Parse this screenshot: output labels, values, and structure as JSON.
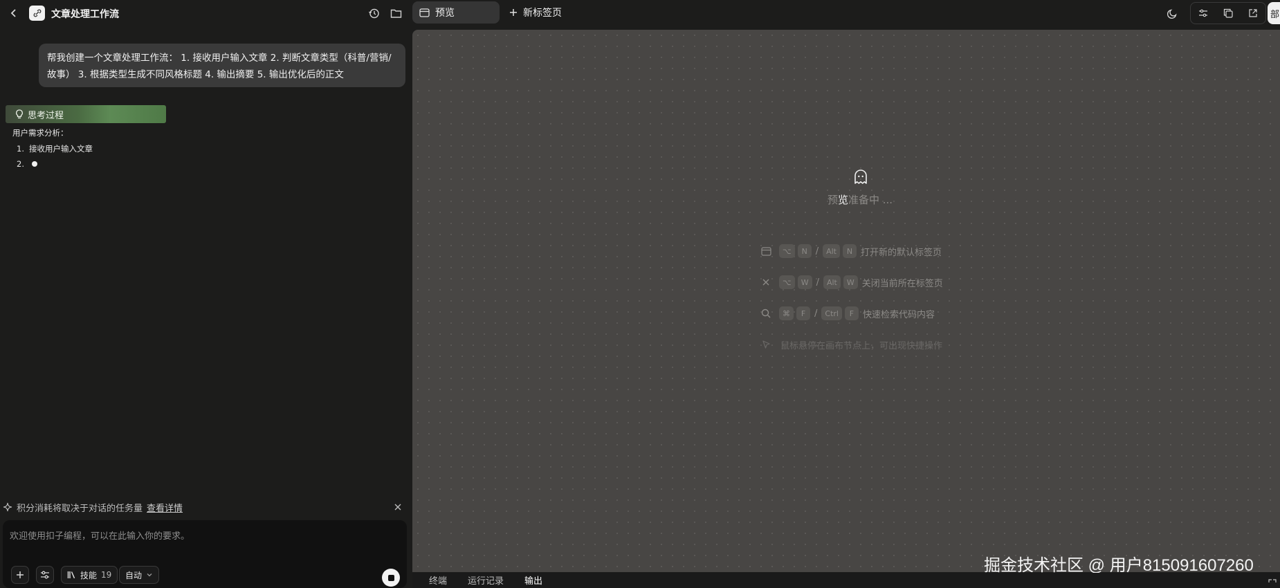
{
  "header": {
    "app_title": "文章处理工作流",
    "app_icon": "link-icon"
  },
  "chat": {
    "user_message": "帮我创建一个文章处理工作流： 1. 接收用户输入文章 2. 判断文章类型（科普/营销/故事） 3. 根据类型生成不同风格标题 4. 输出摘要 5. 输出优化后的正文",
    "thinking_label": "思考过程",
    "analysis_title": "用户需求分析：",
    "analysis_items": [
      {
        "num": "1.",
        "text": "接收用户输入文章"
      },
      {
        "num": "2.",
        "text": ""
      }
    ]
  },
  "credits": {
    "text": "积分消耗将取决于对话的任务量",
    "link": "查看详情"
  },
  "input": {
    "placeholder": "欢迎使用扣子编程，可以在此输入你的要求。",
    "skills_label": "技能",
    "skills_count": "19",
    "mode_label": "自动"
  },
  "tabs": {
    "preview": "预览",
    "new_tab": "新标签页",
    "edge_label": "部"
  },
  "canvas": {
    "ready_pre": "预",
    "ready_highlight": "览",
    "ready_post": "准备中 ...",
    "shortcuts": [
      {
        "icon": "browser-icon",
        "keys_mac": [
          "⌥",
          "N"
        ],
        "keys_win": [
          "Alt",
          "N"
        ],
        "desc": "打开新的默认标签页"
      },
      {
        "icon": "close-icon",
        "keys_mac": [
          "⌥",
          "W"
        ],
        "keys_win": [
          "Alt",
          "W"
        ],
        "desc": "关闭当前所在标签页"
      },
      {
        "icon": "search-icon",
        "keys_mac": [
          "⌘",
          "F"
        ],
        "keys_win": [
          "Ctrl",
          "F"
        ],
        "desc": "快速检索代码内容"
      },
      {
        "icon": "cursor-icon",
        "desc": "鼠标悬停在画布节点上，可出现快捷操作"
      }
    ],
    "slash": "/"
  },
  "watermark": "掘金技术社区 @ 用户815091607260",
  "bottom_tabs": [
    "终端",
    "运行记录",
    "输出"
  ],
  "colors": {
    "thinking_green": "#5d8a55",
    "canvas_bg": "#484644",
    "panel_bg": "#1c1c1b"
  }
}
